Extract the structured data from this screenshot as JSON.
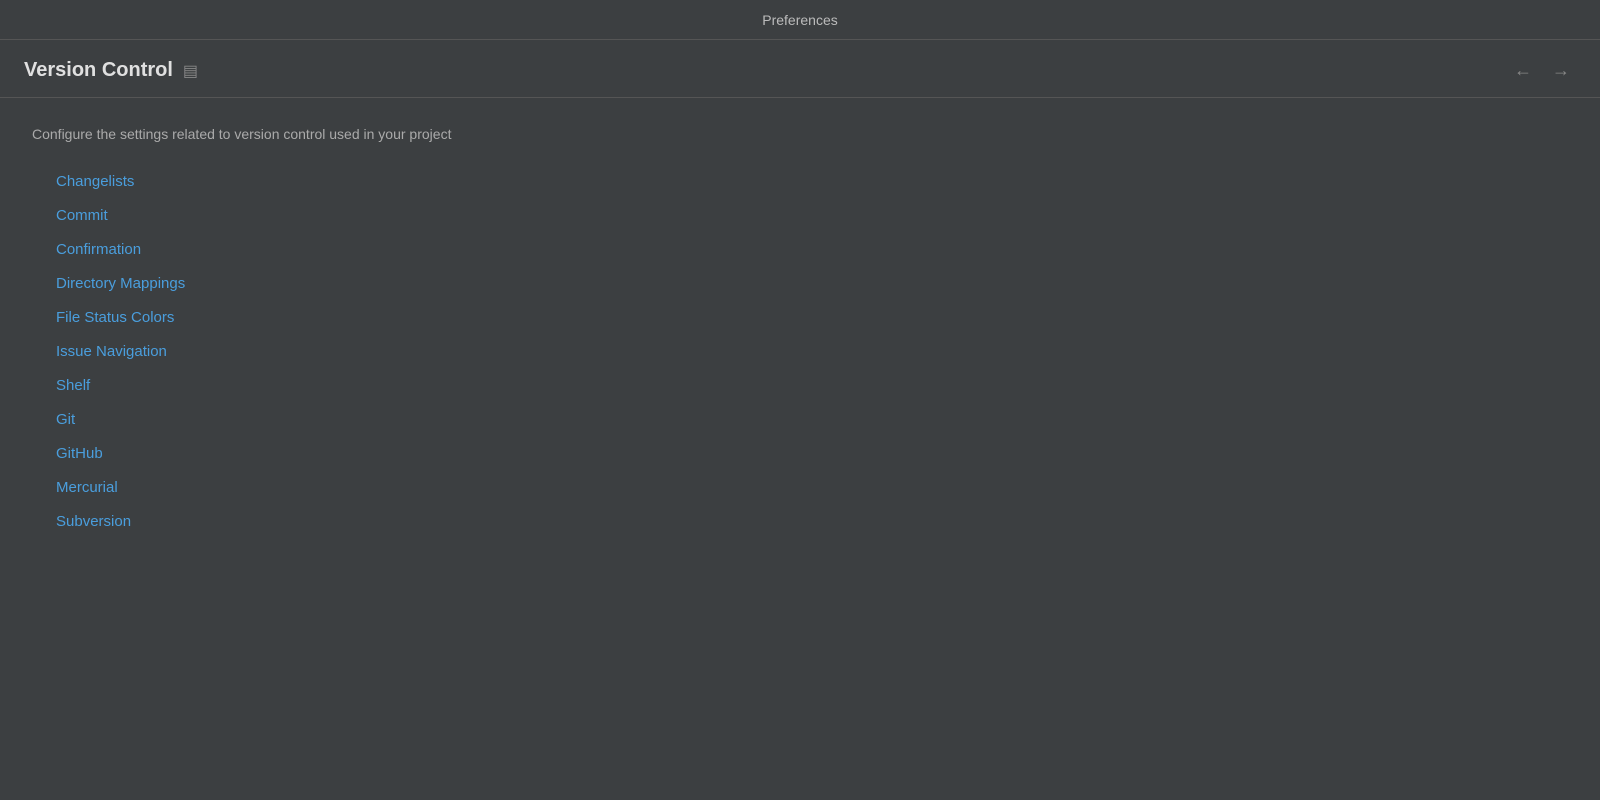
{
  "titleBar": {
    "title": "Preferences"
  },
  "header": {
    "title": "Version Control",
    "icon": "▤",
    "navBack": "←",
    "navForward": "→"
  },
  "description": "Configure the settings related to version control used in your project",
  "navItems": [
    {
      "label": "Changelists",
      "id": "changelists"
    },
    {
      "label": "Commit",
      "id": "commit"
    },
    {
      "label": "Confirmation",
      "id": "confirmation"
    },
    {
      "label": "Directory Mappings",
      "id": "directory-mappings"
    },
    {
      "label": "File Status Colors",
      "id": "file-status-colors"
    },
    {
      "label": "Issue Navigation",
      "id": "issue-navigation"
    },
    {
      "label": "Shelf",
      "id": "shelf"
    },
    {
      "label": "Git",
      "id": "git"
    },
    {
      "label": "GitHub",
      "id": "github"
    },
    {
      "label": "Mercurial",
      "id": "mercurial"
    },
    {
      "label": "Subversion",
      "id": "subversion"
    }
  ]
}
